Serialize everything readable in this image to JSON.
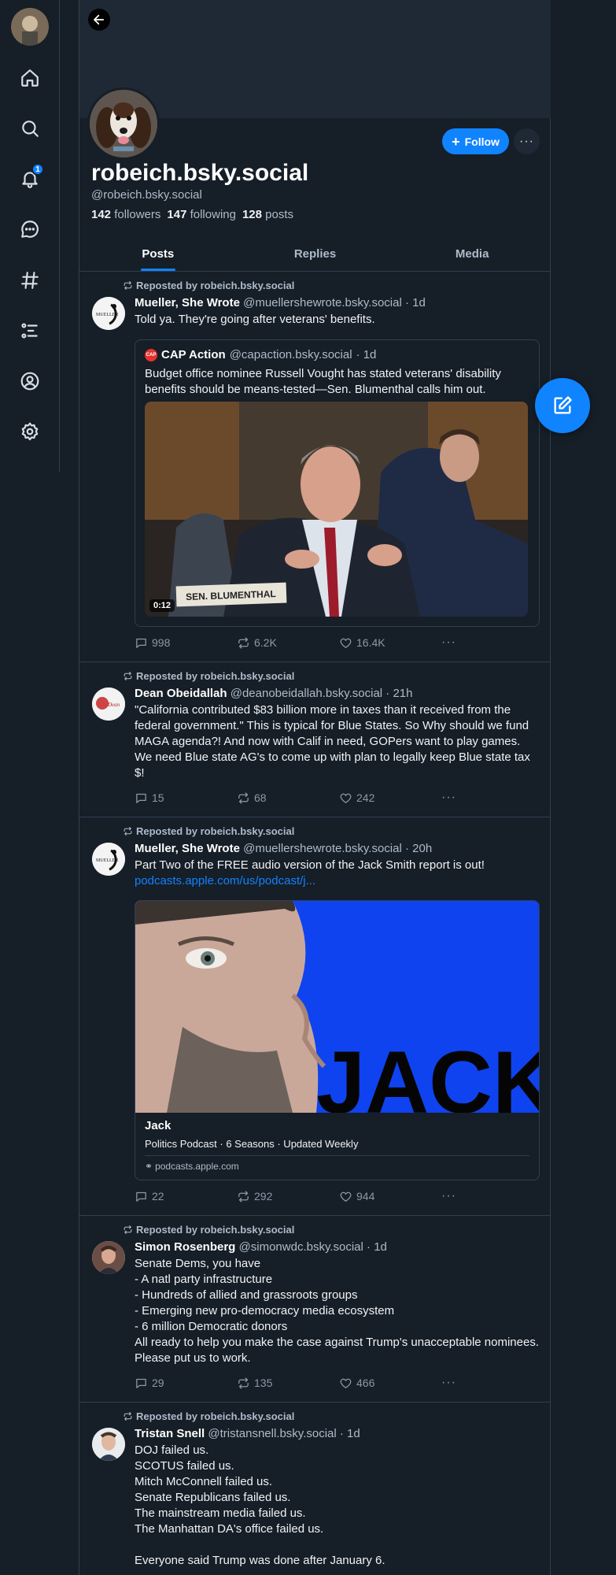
{
  "nav": {
    "notification_count": "1"
  },
  "profile": {
    "display_name": "robeich.bsky.social",
    "handle": "@robeich.bsky.social",
    "followers_count": "142",
    "followers_label": "followers",
    "following_count": "147",
    "following_label": "following",
    "posts_count": "128",
    "posts_label": "posts",
    "follow_label": "Follow",
    "more_label": "···"
  },
  "tabs": [
    {
      "label": "Posts",
      "active": true
    },
    {
      "label": "Replies",
      "active": false
    },
    {
      "label": "Media",
      "active": false
    }
  ],
  "posts": [
    {
      "repost_label": "Reposted by robeich.bsky.social",
      "author": "Mueller, She Wrote",
      "handle": "@muellershewrote.bsky.social",
      "time": "· 1d",
      "text": "Told ya. They're going after veterans' benefits.",
      "quote": {
        "author": "CAP Action",
        "handle": "@capaction.bsky.social",
        "time": "· 1d",
        "text": "Budget office nominee Russell Vought has stated veterans' disability benefits should be means-tested—Sen. Blumenthal calls him out.",
        "nameplate": "SEN. BLUMENTHAL",
        "video_time": "0:12"
      },
      "replies": "998",
      "reposts": "6.2K",
      "likes": "16.4K"
    },
    {
      "repost_label": "Reposted by robeich.bsky.social",
      "author": "Dean Obeidallah",
      "handle": "@deanobeidallah.bsky.social",
      "time": "· 21h",
      "text": "\"California contributed $83 billion more in taxes than it received from the federal government.\" This is typical for Blue States. So Why should we fund MAGA agenda?! And now with Calif in need, GOPers want to play games. We need Blue state AG's to come up with plan to legally keep Blue state tax $!",
      "replies": "15",
      "reposts": "68",
      "likes": "242"
    },
    {
      "repost_label": "Reposted by robeich.bsky.social",
      "author": "Mueller, She Wrote",
      "handle": "@muellershewrote.bsky.social",
      "time": "· 20h",
      "text": "Part Two of the FREE audio version of the Jack Smith report is out!",
      "link": "podcasts.apple.com/us/podcast/j...",
      "card": {
        "image_text": "JACK",
        "title": "Jack",
        "description": "Politics Podcast · 6 Seasons · Updated Weekly",
        "domain": "podcasts.apple.com"
      },
      "replies": "22",
      "reposts": "292",
      "likes": "944"
    },
    {
      "repost_label": "Reposted by robeich.bsky.social",
      "author": "Simon Rosenberg",
      "handle": "@simonwdc.bsky.social",
      "time": "· 1d",
      "text": "Senate Dems, you have\n- A natl party infrastructure\n- Hundreds of allied and grassroots groups\n- Emerging new pro-democracy media ecosystem\n- 6 million Democratic donors\nAll ready to help you make the case against Trump's unacceptable nominees.  Please put us to work.",
      "replies": "29",
      "reposts": "135",
      "likes": "466"
    },
    {
      "repost_label": "Reposted by robeich.bsky.social",
      "author": "Tristan Snell",
      "handle": "@tristansnell.bsky.social",
      "time": "· 1d",
      "text": "DOJ failed us.\nSCOTUS failed us.\nMitch McConnell failed us.\nSenate Republicans failed us.\nThe mainstream media failed us.\nThe Manhattan DA's office failed us.\n\nEveryone said Trump was done after January 6."
    }
  ]
}
